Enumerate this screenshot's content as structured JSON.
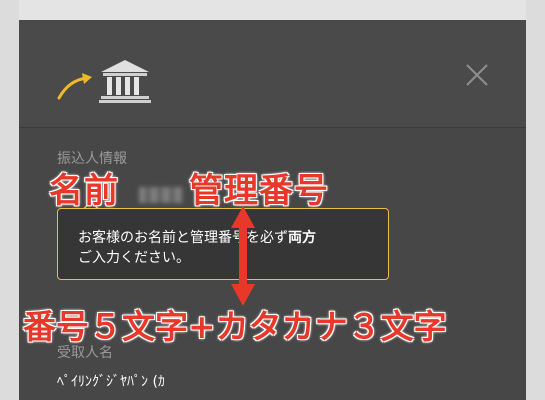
{
  "panel": {
    "close_symbol": "✕",
    "colors": {
      "panel_bg": "#474747",
      "accent_yellow": "#e6c33b",
      "annotation_red": "#e8382a"
    }
  },
  "header": {
    "icons": [
      "transfer-arrow-icon",
      "bank-icon",
      "close-icon"
    ]
  },
  "sender_section": {
    "label": "振込人情報"
  },
  "tooltip": {
    "text_prefix": "お客様のお名前と管理番号を必ず",
    "text_bold": "両方",
    "text_line2": "ご入力ください。"
  },
  "recipient_section": {
    "label": "受取人名",
    "value": "ﾍﾟｲﾘﾝｸﾞｼﾞﾔﾊﾟﾝ (ｶ"
  },
  "annotations": {
    "name": "名前",
    "kanri": "管理番号",
    "rule": "番号５文字+カタカナ３文字"
  }
}
